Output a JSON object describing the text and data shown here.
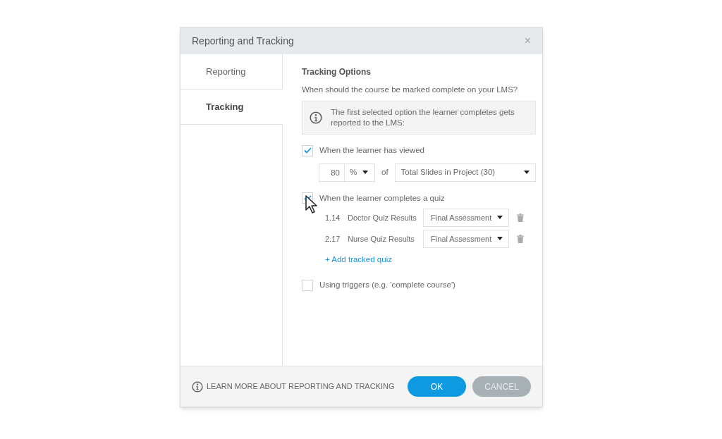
{
  "window": {
    "title": "Reporting and Tracking",
    "close": "×"
  },
  "tabs": [
    {
      "label": "Reporting",
      "selected": false
    },
    {
      "label": "Tracking",
      "selected": true
    }
  ],
  "section": {
    "title": "Tracking Options",
    "question": "When should the course be marked complete on your LMS?",
    "info": "The first selected option the learner completes gets reported to the LMS:"
  },
  "options": [
    {
      "kind": "viewed",
      "label": "When the learner has viewed",
      "checked": true,
      "amount": "80",
      "unit": "%",
      "of": "of",
      "target": "Total Slides in Project (30)"
    },
    {
      "kind": "quiz",
      "label": "When the learner completes a quiz",
      "checked": true,
      "quizzes": [
        {
          "number": "1.14",
          "name": "Doctor Quiz Results",
          "assessment": "Final Assessment"
        },
        {
          "number": "2.17",
          "name": "Nurse Quiz Results",
          "assessment": "Final Assessment"
        }
      ],
      "add": "+ Add tracked quiz"
    },
    {
      "kind": "plain",
      "label": "Using triggers (e.g. 'complete course')",
      "checked": false
    }
  ],
  "footer": {
    "link": "LEARN MORE ABOUT REPORTING AND TRACKING",
    "buttons": [
      {
        "label": "OK",
        "kind": "primary"
      },
      {
        "label": "CANCEL",
        "kind": "secondary"
      }
    ]
  }
}
